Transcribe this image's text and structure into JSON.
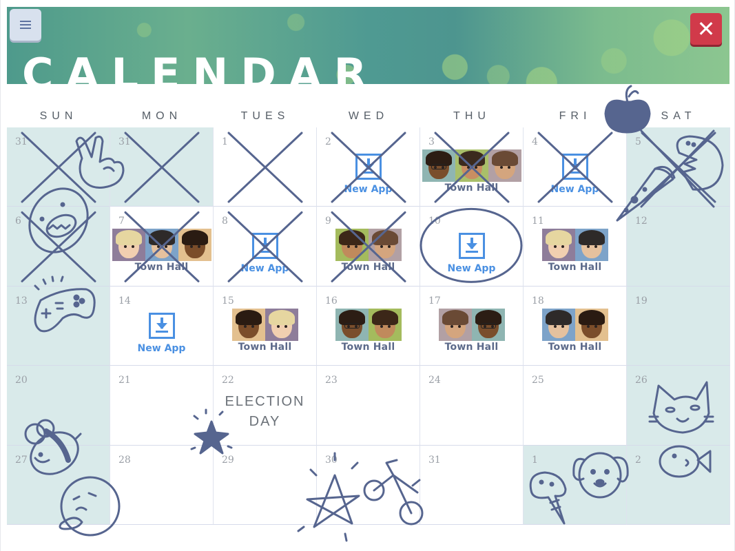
{
  "header": {
    "title": "CALENDAR",
    "menu_icon": "hamburger-menu-icon",
    "close_icon": "close-icon",
    "close_glyph": "✕",
    "colors": {
      "banner": "#4f9a92",
      "close": "#d13a4a",
      "menu": "#d8e1ee"
    }
  },
  "weekdays": [
    "SUN",
    "MON",
    "TUES",
    "WED",
    "THU",
    "FRI",
    "SAT"
  ],
  "colors": {
    "accent": "#4a90e2",
    "doodle": "#56658f",
    "weekend": "#d9eaea",
    "town_hall_text": "#5c6a8a"
  },
  "event_labels": {
    "town_hall": "Town Hall",
    "new_app": "New App"
  },
  "weeks": [
    [
      {
        "day": "31",
        "shade": true,
        "crossed": true
      },
      {
        "day": "31",
        "shade": true,
        "crossed": true
      },
      {
        "day": "1",
        "crossed": true
      },
      {
        "day": "2",
        "crossed": true,
        "event": "new_app"
      },
      {
        "day": "3",
        "crossed": true,
        "event": "town_hall",
        "faces": [
          "glasses-dark",
          "boy-green",
          "girl-brown"
        ]
      },
      {
        "day": "4",
        "crossed": true,
        "event": "new_app"
      },
      {
        "day": "5",
        "shade": true,
        "crossed": true
      }
    ],
    [
      {
        "day": "6",
        "shade": true,
        "crossed": true
      },
      {
        "day": "7",
        "crossed": true,
        "event": "town_hall",
        "faces": [
          "blonde",
          "dark-hair",
          "curly"
        ]
      },
      {
        "day": "8",
        "crossed": true,
        "event": "new_app"
      },
      {
        "day": "9",
        "crossed": true,
        "event": "town_hall",
        "faces": [
          "girl-green",
          "girl-brown"
        ]
      },
      {
        "day": "10",
        "circled": true,
        "event": "new_app"
      },
      {
        "day": "11",
        "event": "town_hall",
        "faces": [
          "blonde",
          "dark-hair"
        ]
      },
      {
        "day": "12",
        "shade": true
      }
    ],
    [
      {
        "day": "13",
        "shade": true
      },
      {
        "day": "14",
        "event": "new_app"
      },
      {
        "day": "15",
        "event": "town_hall",
        "faces": [
          "curly",
          "blonde"
        ]
      },
      {
        "day": "16",
        "event": "town_hall",
        "faces": [
          "glasses-dark",
          "girl-green"
        ]
      },
      {
        "day": "17",
        "event": "town_hall",
        "faces": [
          "girl-brown",
          "glasses-dark"
        ]
      },
      {
        "day": "18",
        "event": "town_hall",
        "faces": [
          "dark-hair",
          "curly"
        ]
      },
      {
        "day": "19",
        "shade": true
      }
    ],
    [
      {
        "day": "20",
        "shade": true
      },
      {
        "day": "21"
      },
      {
        "day": "22",
        "note": [
          "ELECTION",
          "DAY"
        ]
      },
      {
        "day": "23"
      },
      {
        "day": "24"
      },
      {
        "day": "25"
      },
      {
        "day": "26",
        "shade": true
      }
    ],
    [
      {
        "day": "27",
        "shade": true
      },
      {
        "day": "28"
      },
      {
        "day": "29"
      },
      {
        "day": "30"
      },
      {
        "day": "31"
      },
      {
        "day": "1",
        "shade": true
      },
      {
        "day": "2",
        "shade": true
      }
    ]
  ],
  "doodles": [
    "peace-hand",
    "monster-face",
    "gamepad",
    "apple",
    "pizza",
    "pac-monster",
    "star-small",
    "bee",
    "thinking-face",
    "star-large",
    "bicycle",
    "cat",
    "fish",
    "dog",
    "ice-cream"
  ]
}
